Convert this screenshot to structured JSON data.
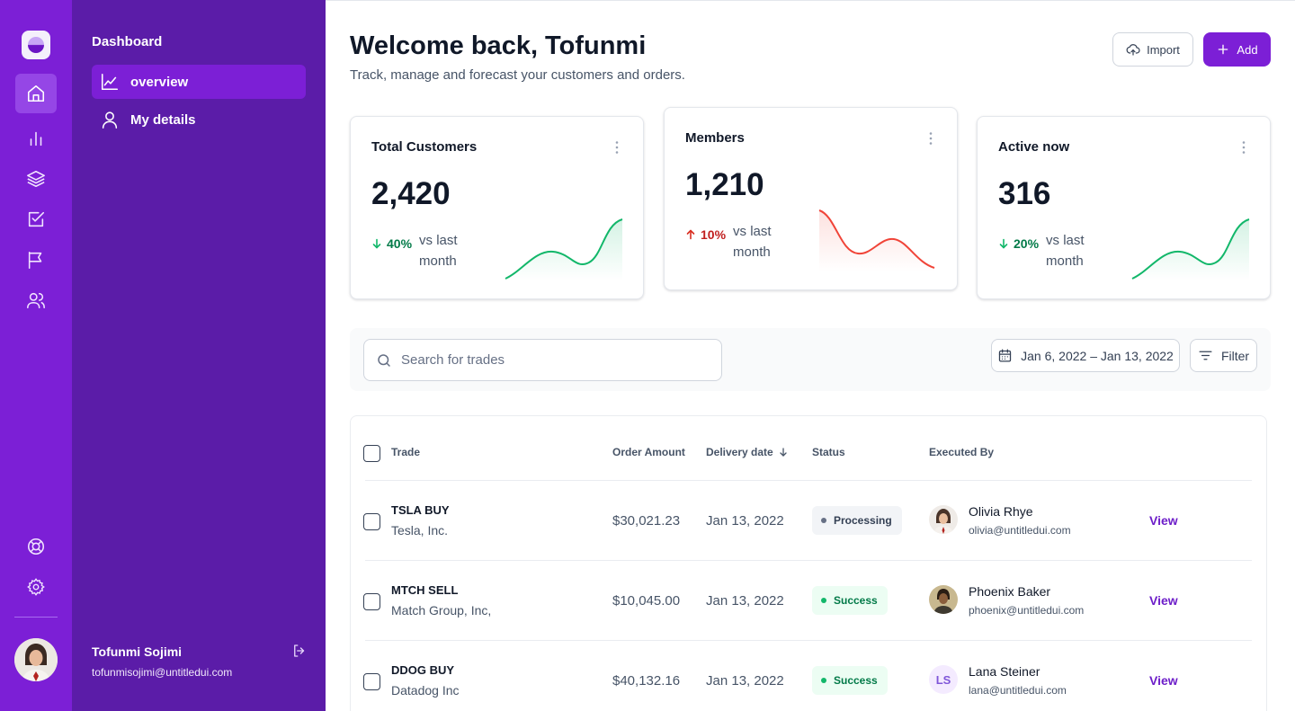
{
  "colors": {
    "rail_bg": "#7c1fd6",
    "subnav_bg": "#5b1ca8",
    "accent": "#7c1fd6",
    "positive": "#027a48",
    "negative": "#c11f1f",
    "spark_positive": "#12b76a",
    "spark_negative": "#f04438"
  },
  "rail": {
    "logo_icon": "logo-icon",
    "items": [
      {
        "icon": "home-icon",
        "active": true
      },
      {
        "icon": "bar-chart-icon",
        "active": false
      },
      {
        "icon": "layers-icon",
        "active": false
      },
      {
        "icon": "check-square-icon",
        "active": false
      },
      {
        "icon": "flag-icon",
        "active": false
      },
      {
        "icon": "users-icon",
        "active": false
      }
    ],
    "bottom_items": [
      {
        "icon": "life-buoy-icon"
      },
      {
        "icon": "settings-icon"
      }
    ]
  },
  "subnav": {
    "title": "Dashboard",
    "items": [
      {
        "label": "overview",
        "icon": "line-chart-icon",
        "active": true
      },
      {
        "label": "My details",
        "icon": "user-icon",
        "active": false
      }
    ],
    "user": {
      "name": "Tofunmi Sojimi",
      "email": "tofunmisojimi@untitledui.com"
    }
  },
  "header": {
    "title": "Welcome back, Tofunmi",
    "subtitle": "Track, manage and forecast your customers and orders.",
    "import_label": "Import",
    "add_label": "Add"
  },
  "stats": [
    {
      "title": "Total Customers",
      "value": "2,420",
      "change": "40%",
      "direction": "down",
      "compare": "vs last month",
      "trend": "positive"
    },
    {
      "title": "Members",
      "value": "1,210",
      "change": "10%",
      "direction": "up",
      "compare": "vs last month",
      "trend": "negative"
    },
    {
      "title": "Active now",
      "value": "316",
      "change": "20%",
      "direction": "down",
      "compare": "vs last month",
      "trend": "positive"
    }
  ],
  "filters": {
    "search_placeholder": "Search for trades",
    "date_range": "Jan 6, 2022 – Jan 13, 2022",
    "filter_label": "Filter"
  },
  "table": {
    "columns": {
      "trade": "Trade",
      "order_amount": "Order Amount",
      "delivery_date": "Delivery date",
      "status": "Status",
      "executed_by": "Executed By"
    },
    "rows": [
      {
        "trade": "TSLA BUY",
        "company": "Tesla, Inc.",
        "amount": "$30,021.23",
        "date": "Jan 13, 2022",
        "status": "Processing",
        "status_type": "processing",
        "person": "Olivia Rhye",
        "email": "olivia@untitledui.com",
        "avatar": "photo",
        "action": "View"
      },
      {
        "trade": "MTCH SELL",
        "company": "Match Group, Inc,",
        "amount": "$10,045.00",
        "date": "Jan 13, 2022",
        "status": "Success",
        "status_type": "success",
        "person": "Phoenix Baker",
        "email": "phoenix@untitledui.com",
        "avatar": "photo",
        "action": "View"
      },
      {
        "trade": "DDOG BUY",
        "company": "Datadog Inc",
        "amount": "$40,132.16",
        "date": "Jan 13, 2022",
        "status": "Success",
        "status_type": "success",
        "person": "Lana Steiner",
        "email": "lana@untitledui.com",
        "avatar": "LS",
        "action": "View"
      }
    ]
  }
}
